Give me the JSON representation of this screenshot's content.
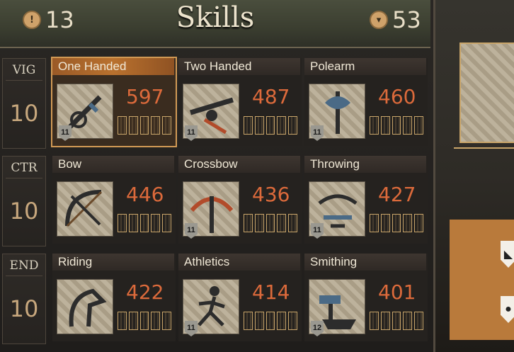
{
  "header": {
    "title": "Skills",
    "attribute_points": "13",
    "focus_points": "53",
    "attribute_icon": "attribute-point-icon",
    "focus_icon": "focus-point-icon"
  },
  "attributes": [
    {
      "name": "VIG",
      "value": "10"
    },
    {
      "name": "CTR",
      "value": "10"
    },
    {
      "name": "END",
      "value": "10"
    }
  ],
  "skills": [
    {
      "name": "One Handed",
      "value": "597",
      "focus": "11",
      "icon": "one-handed-icon",
      "selected": true
    },
    {
      "name": "Two Handed",
      "value": "487",
      "focus": "11",
      "icon": "two-handed-icon",
      "selected": false
    },
    {
      "name": "Polearm",
      "value": "460",
      "focus": "11",
      "icon": "polearm-icon",
      "selected": false
    },
    {
      "name": "Bow",
      "value": "446",
      "focus": "",
      "icon": "bow-icon",
      "selected": false
    },
    {
      "name": "Crossbow",
      "value": "436",
      "focus": "11",
      "icon": "crossbow-icon",
      "selected": false
    },
    {
      "name": "Throwing",
      "value": "427",
      "focus": "11",
      "icon": "throwing-icon",
      "selected": false
    },
    {
      "name": "Riding",
      "value": "422",
      "focus": "",
      "icon": "riding-icon",
      "selected": false
    },
    {
      "name": "Athletics",
      "value": "414",
      "focus": "11",
      "icon": "athletics-icon",
      "selected": false
    },
    {
      "name": "Smithing",
      "value": "401",
      "focus": "12",
      "icon": "smithing-icon",
      "selected": false
    }
  ],
  "colors": {
    "value_orange": "#dc6a3b",
    "selected_title": "#b9712e",
    "bar_gold": "#c9a56a"
  }
}
